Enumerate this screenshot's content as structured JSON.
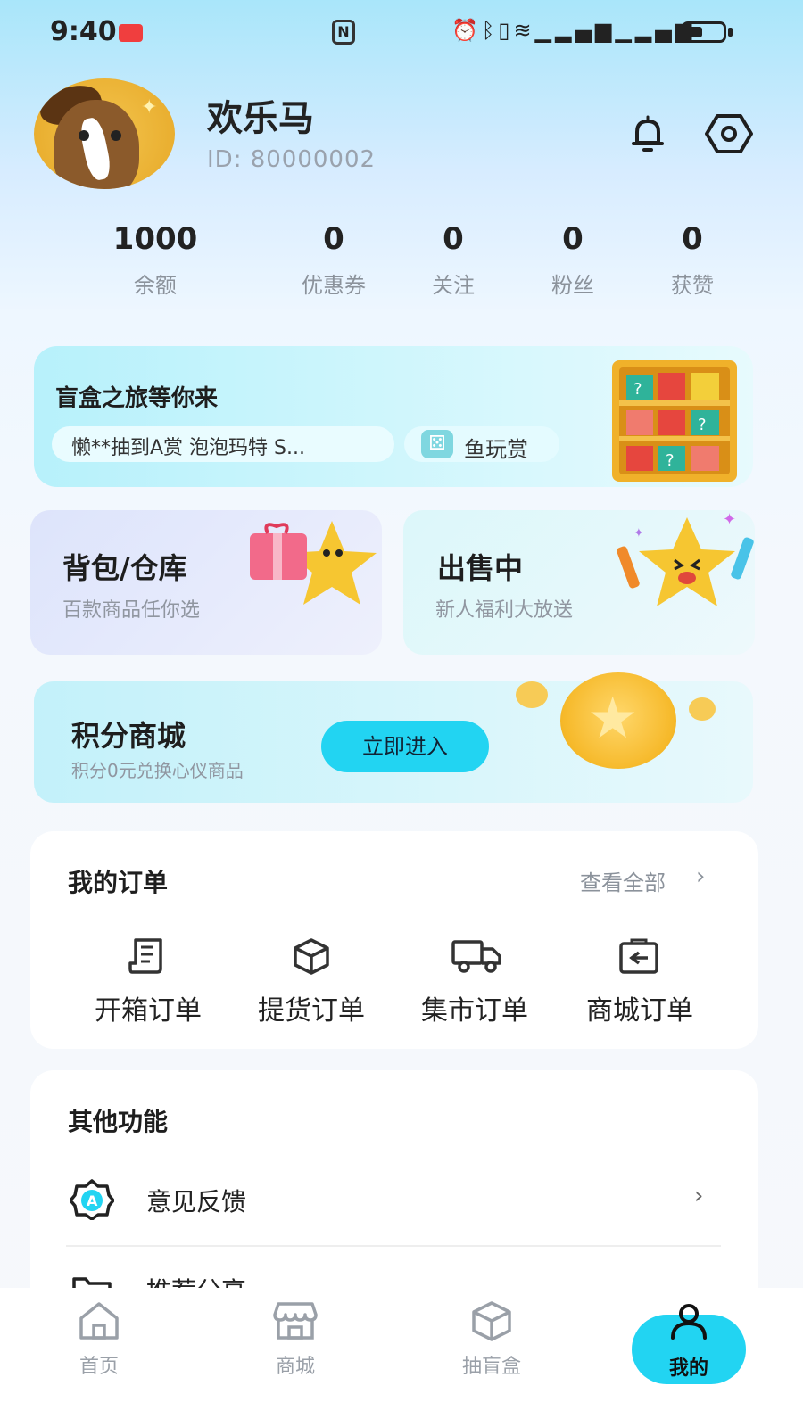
{
  "status_bar": {
    "time": "9:40",
    "icons": [
      "alarm-icon",
      "bluetooth-icon",
      "vibrate-icon",
      "wifi-icon",
      "signal-icon",
      "signal-icon"
    ],
    "battery_level": 0.45
  },
  "profile": {
    "nickname": "欢乐马",
    "user_id": "ID: 80000002",
    "avatar": "horse-avatar"
  },
  "header_actions": {
    "notification_icon": "bell-icon",
    "settings_icon": "settings-hexagon-icon"
  },
  "stats": [
    {
      "value": "1000",
      "label": "余额"
    },
    {
      "value": "0",
      "label": "优惠券"
    },
    {
      "value": "0",
      "label": "关注"
    },
    {
      "value": "0",
      "label": "粉丝"
    },
    {
      "value": "0",
      "label": "获赞"
    }
  ],
  "blind_box_banner": {
    "title": "盲盒之旅等你来",
    "ticker": "懒**抽到A赏 泡泡玛特 S...",
    "tag": "鱼玩赏"
  },
  "backpack_card": {
    "title": "背包/仓库",
    "subtitle": "百款商品任你选"
  },
  "selling_card": {
    "title": "出售中",
    "subtitle": "新人福利大放送"
  },
  "points_mall": {
    "title": "积分商城",
    "subtitle": "积分0元兑换心仪商品",
    "button": "立即进入"
  },
  "orders": {
    "title": "我的订单",
    "view_all": "查看全部",
    "items": [
      {
        "label": "开箱订单",
        "icon": "receipt-icon"
      },
      {
        "label": "提货订单",
        "icon": "box-icon"
      },
      {
        "label": "集市订单",
        "icon": "truck-icon"
      },
      {
        "label": "商城订单",
        "icon": "return-bag-icon"
      }
    ]
  },
  "other_functions": {
    "title": "其他功能",
    "items": [
      {
        "label": "意见反馈",
        "icon": "feedback-badge-icon"
      },
      {
        "label": "推荐分享",
        "icon": "folder-icon"
      }
    ]
  },
  "bottom_nav": {
    "items": [
      {
        "label": "首页",
        "icon": "home-icon"
      },
      {
        "label": "商城",
        "icon": "store-icon"
      },
      {
        "label": "抽盲盒",
        "icon": "box-icon"
      },
      {
        "label": "我的",
        "icon": "user-icon"
      }
    ],
    "active_index": 3
  },
  "colors": {
    "accent": "#22d4f2",
    "text_primary": "#222222",
    "text_secondary": "#8b929b"
  }
}
